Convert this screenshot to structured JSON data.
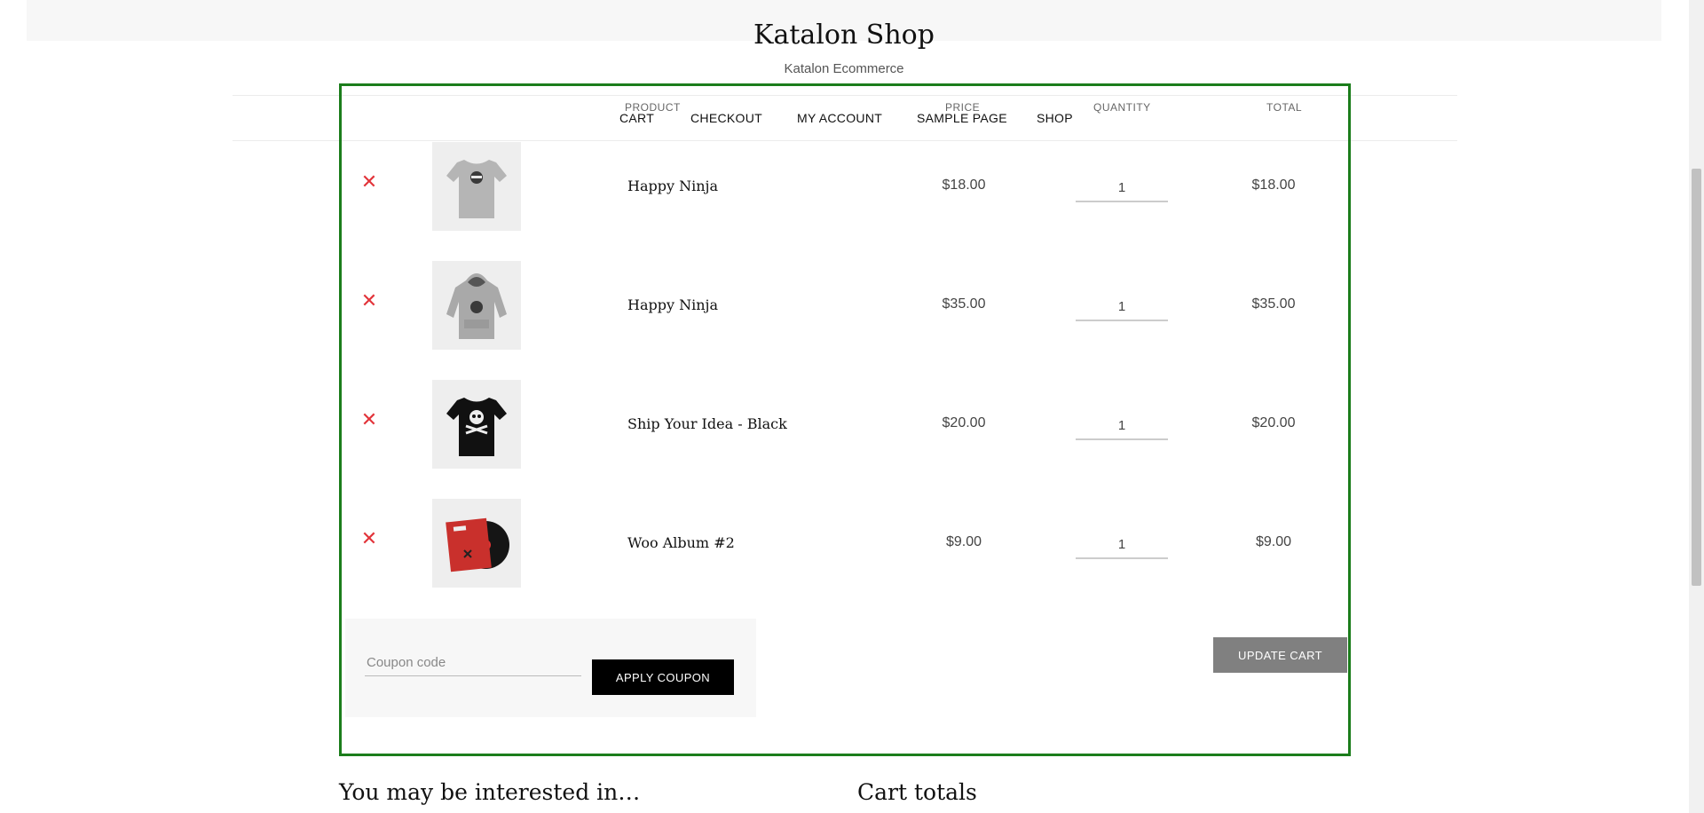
{
  "header": {
    "site_title": "Katalon Shop",
    "tagline": "Katalon Ecommerce"
  },
  "nav": {
    "items": [
      "CART",
      "CHECKOUT",
      "MY ACCOUNT",
      "SAMPLE PAGE",
      "SHOP"
    ]
  },
  "cart_table": {
    "columns": {
      "product": "PRODUCT",
      "price": "PRICE",
      "quantity": "QUANTITY",
      "total": "TOTAL"
    },
    "remove_icon": "close-icon",
    "rows": [
      {
        "name": "Happy Ninja",
        "price": "$18.00",
        "quantity": "1",
        "total": "$18.00",
        "image_icon": "tshirt-grey-icon"
      },
      {
        "name": "Happy Ninja",
        "price": "$35.00",
        "quantity": "1",
        "total": "$35.00",
        "image_icon": "hoodie-grey-icon"
      },
      {
        "name": "Ship Your Idea - Black",
        "price": "$20.00",
        "quantity": "1",
        "total": "$20.00",
        "image_icon": "tshirt-black-icon"
      },
      {
        "name": "Woo Album #2",
        "price": "$9.00",
        "quantity": "1",
        "total": "$9.00",
        "image_icon": "album-icon"
      }
    ]
  },
  "coupon": {
    "placeholder": "Coupon code",
    "apply_label": "APPLY COUPON"
  },
  "update_cart_label": "UPDATE CART",
  "sections": {
    "interested": "You may be interested in…",
    "cart_totals": "Cart totals"
  },
  "colors": {
    "frame": "#1b7d1b",
    "remove": "#e2343a",
    "apply_button": "#000000",
    "update_button": "#808080"
  }
}
